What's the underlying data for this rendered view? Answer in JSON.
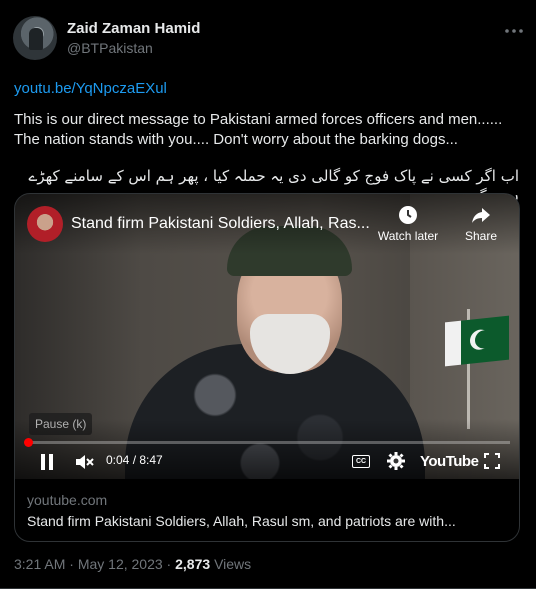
{
  "tweet": {
    "author_name": "Zaid Zaman Hamid",
    "author_handle": "@BTPakistan",
    "link": "youtu.be/YqNpczaEXul",
    "text_line1": "This is our direct message to Pakistani armed forces officers and men......",
    "text_line2": "The nation stands with you.... Don't worry about the barking dogs...",
    "urdu_text": "اب اگر کسی نے پاک فوج کو گالی دی یہ حملہ کیا ، پھر ہم اس کے سامنے کھڑے ہوں گے....",
    "time": "3:21 AM",
    "date": "May 12, 2023",
    "views_count": "2,873",
    "views_label": "Views"
  },
  "video": {
    "title": "Stand firm Pakistani Soldiers, Allah, Ras...",
    "watch_later": "Watch later",
    "share": "Share",
    "pause_tooltip": "Pause (k)",
    "current_time": "0:04",
    "duration": "8:47",
    "time_separator": " / ",
    "brand": "YouTube",
    "progress": 0.0076,
    "cc_label": "CC"
  },
  "card": {
    "domain": "youtube.com",
    "title": "Stand firm Pakistani Soldiers, Allah, Rasul sm, and patriots are with..."
  },
  "colors": {
    "link": "#1d9bf0",
    "secondary_text": "#71767b",
    "progress": "#ff0000"
  }
}
